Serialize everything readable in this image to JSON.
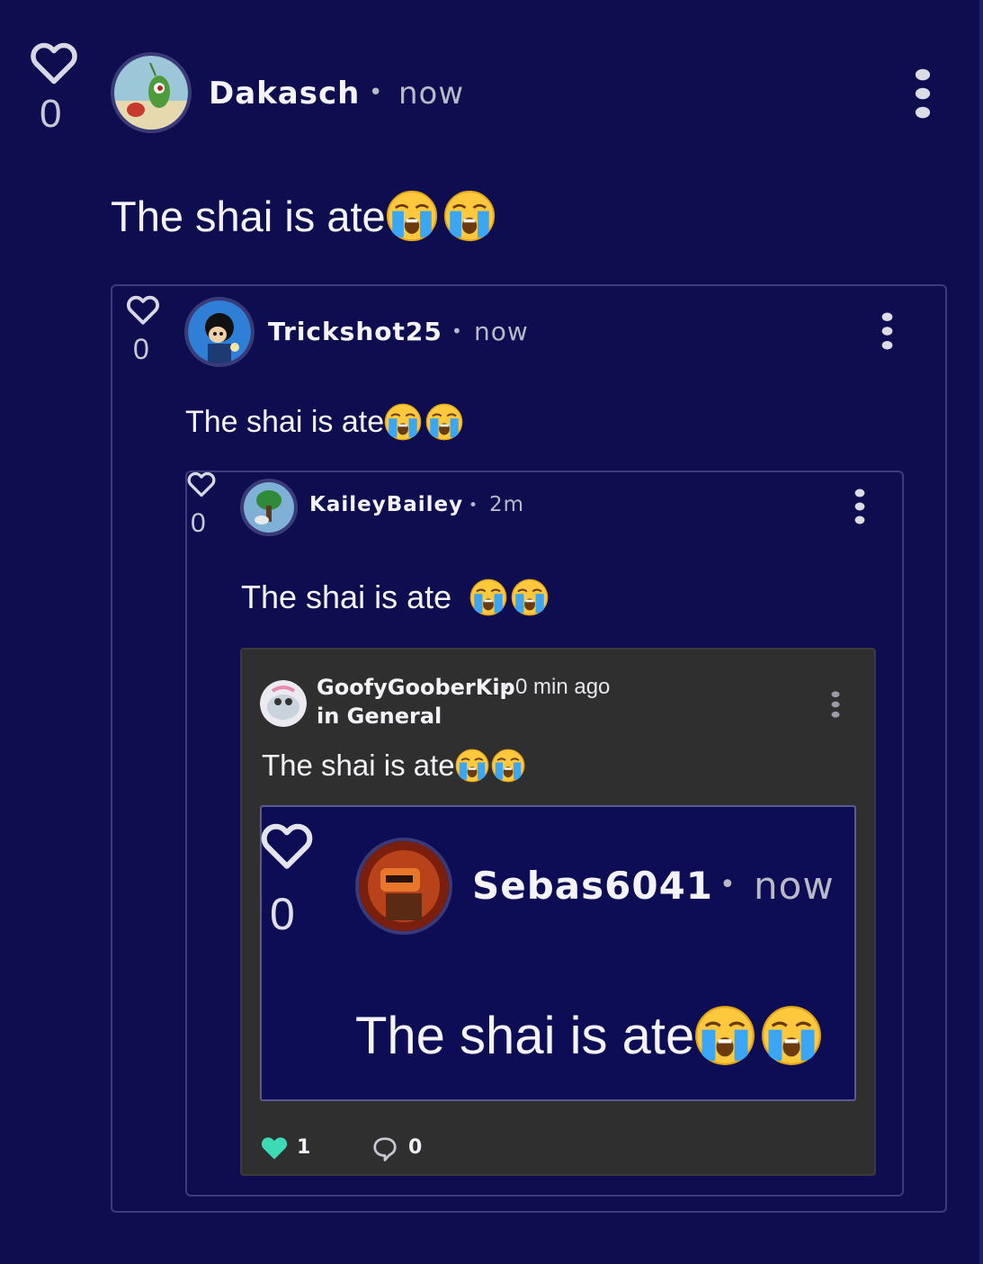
{
  "colors": {
    "background": "#0d0d4f",
    "dark_card": "#2f2f2f",
    "like_heart": "#3ddbb4"
  },
  "post": {
    "like_count": "0",
    "username": "Dakasch",
    "separator": "•",
    "time": "now",
    "text": "The shai is ate"
  },
  "reply1": {
    "like_count": "0",
    "username": "Trickshot25",
    "separator": "•",
    "time": "now",
    "text": "The shai is ate"
  },
  "reply2": {
    "like_count": "0",
    "username": "KaileyBailey",
    "separator": "•",
    "time": "2m",
    "text": "The shai is ate "
  },
  "reply3": {
    "username": "GoofyGooberKip",
    "separator": "•",
    "time": "0 min ago",
    "community": "in General",
    "text": "The shai is ate",
    "likes": "1",
    "comments": "0"
  },
  "reply4": {
    "like_count": "0",
    "username": "Sebas6041",
    "separator": "•",
    "time": "now",
    "text": "The shai is ate"
  },
  "icons": [
    "heart-icon",
    "more-vertical-icon",
    "loudly-crying-face-emoji",
    "speech-bubble-icon"
  ]
}
